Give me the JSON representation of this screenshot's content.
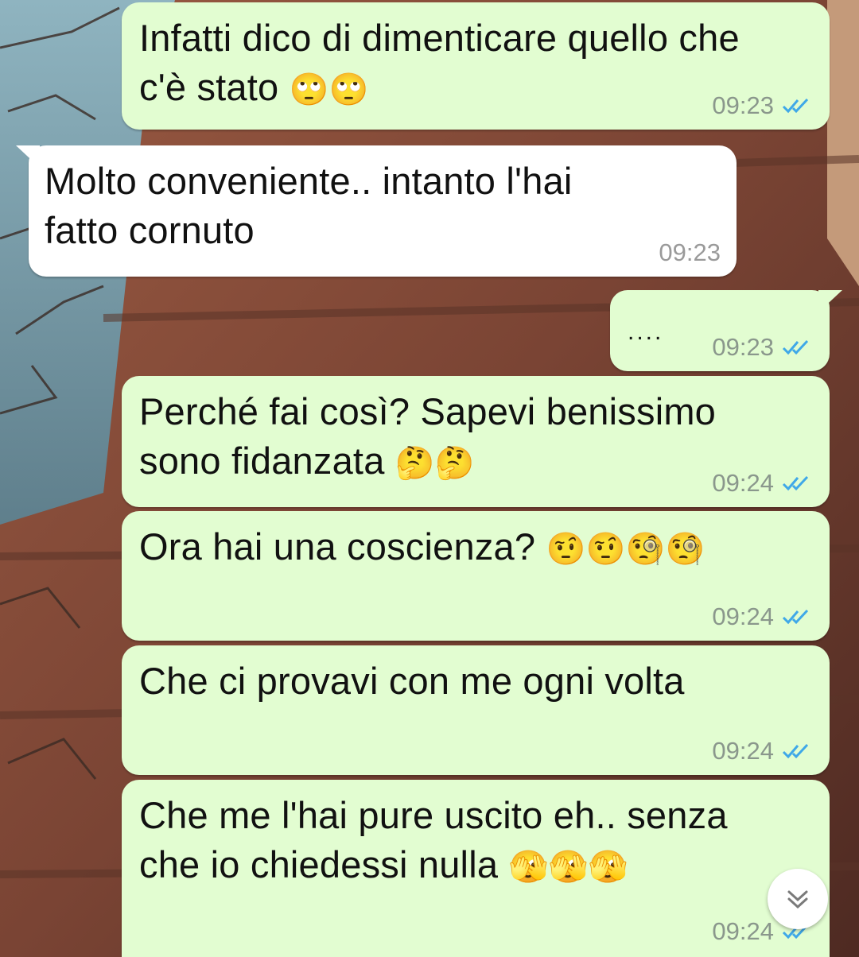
{
  "colors": {
    "outgoing_bubble": "#e2fdd1",
    "incoming_bubble": "#ffffff",
    "read_ticks": "#3fa8e8"
  },
  "messages": [
    {
      "direction": "out",
      "text": "Infatti dico di dimenticare quello che",
      "text2": "c'è stato",
      "emoji": "🙄🙄",
      "time": "09:23",
      "status": "read"
    },
    {
      "direction": "in",
      "text": "Molto conveniente.. intanto l'hai",
      "text2": "fatto cornuto",
      "time": "09:23"
    },
    {
      "direction": "out",
      "text": "....",
      "time": "09:23",
      "status": "read"
    },
    {
      "direction": "out",
      "text": "Perché fai così? Sapevi benissimo",
      "text2": "sono fidanzata",
      "emoji": "🤔🤔",
      "time": "09:24",
      "status": "read"
    },
    {
      "direction": "out",
      "text": "Ora hai una coscienza?",
      "emoji": "🤨🤨🧐🧐",
      "time": "09:24",
      "status": "read"
    },
    {
      "direction": "out",
      "text": "Che ci provavi con me ogni volta",
      "time": "09:24",
      "status": "read"
    },
    {
      "direction": "out",
      "text": "Che me l'hai pure uscito eh.. senza",
      "text2": "che io chiedessi nulla",
      "emoji": "🫣🫣🫣",
      "time": "09:24",
      "status": "read"
    }
  ],
  "scroll_button": {
    "icon": "chevron-down-icon"
  }
}
